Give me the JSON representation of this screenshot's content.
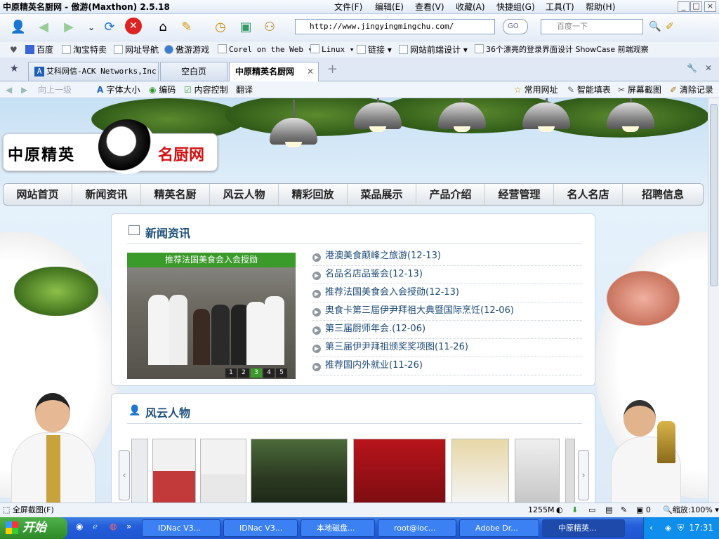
{
  "window": {
    "title": "中原精英名厨网 - 傲游(Maxthon) 2.5.18",
    "menus": [
      "文件(F)",
      "编辑(E)",
      "查看(V)",
      "收藏(A)",
      "快捷组(G)",
      "工具(T)",
      "帮助(H)"
    ]
  },
  "address": {
    "url": "http://www.jingyingmingchu.com/",
    "go_label": "GO"
  },
  "search": {
    "placeholder": "百度一下"
  },
  "favorites": [
    "百度",
    "淘宝特卖",
    "网址导航",
    "傲游游戏",
    "Corel on the Web",
    "Linux",
    "链接",
    "网站前端设计",
    "36个漂亮的登录界面设计 ShowCase 前端观察"
  ],
  "tabs": [
    "艾科网信-ACK Networks,Inc.",
    "空白页",
    "中原精英名厨网"
  ],
  "page_toolbar": {
    "up": "向上一级",
    "font_size": "字体大小",
    "encoding": "编码",
    "content_control": "内容控制",
    "translate": "翻译",
    "common_urls": "常用网址",
    "smart_fill": "智能填表",
    "screenshot": "屏幕截图",
    "clear_history": "清除记录"
  },
  "site": {
    "logo_left": "中原精英",
    "logo_right": "名厨网",
    "nav": [
      "网站首页",
      "新闻资讯",
      "精英名厨",
      "风云人物",
      "精彩回放",
      "菜品展示",
      "产品介绍",
      "经营管理",
      "名人名店",
      "招聘信息"
    ],
    "news": {
      "title": "新闻资讯",
      "photo_caption": "推荐法国美食会入会授勋",
      "photo_pages": [
        "1",
        "2",
        "3",
        "4",
        "5"
      ],
      "items": [
        "港澳美食颠峰之旅游(12-13)",
        "名品名店品鉴会(12-13)",
        "推荐法国美食会入会授勋(12-13)",
        "奥食卡第三届伊尹拜祖大典暨国际烹饪(12-06)",
        "第三届厨师年会.(12-06)",
        "第三届伊尹拜祖颁奖奖项图(11-26)",
        "推荐国内外就业(11-26)"
      ]
    },
    "people": {
      "title": "风云人物"
    }
  },
  "status": {
    "fullscreen_shot": "全屏截图(F)",
    "memory": "1255M",
    "counter": "0",
    "zoom": "缩放:100%"
  },
  "taskbar": {
    "start": "开始",
    "buttons": [
      "IDNac V3...",
      "IDNac V3...",
      "本地磁盘...",
      "root@loc...",
      "Adobe Dr...",
      "中原精英..."
    ],
    "clock": "17:31"
  }
}
